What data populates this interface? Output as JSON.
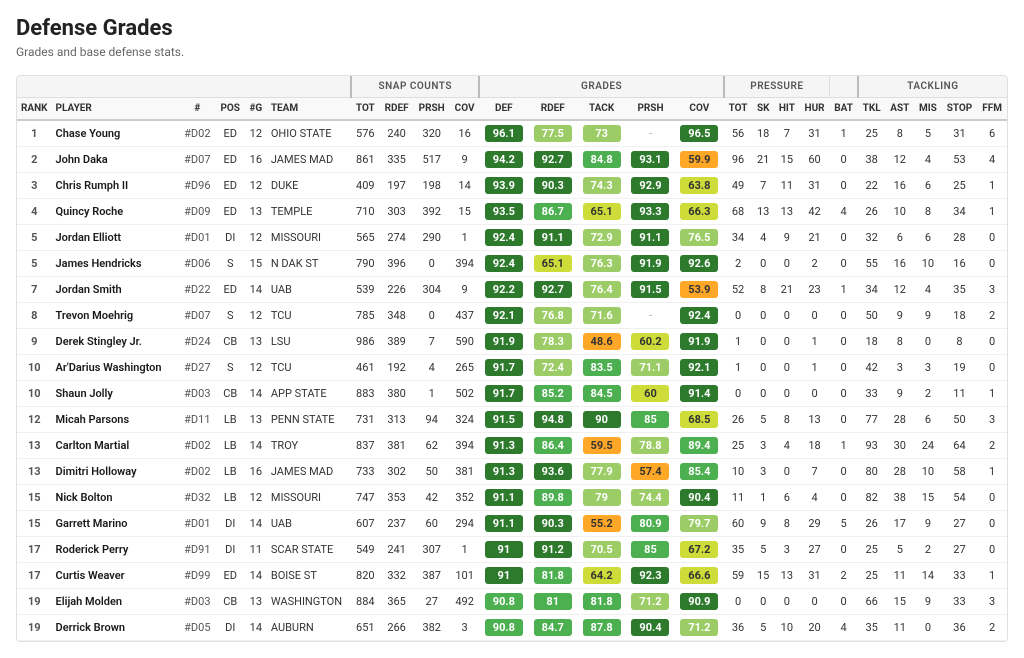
{
  "title": "Defense Grades",
  "subtitle": "Grades and base defense stats.",
  "groups": [
    {
      "label": "",
      "span": 6
    },
    {
      "label": "SNAP COUNTS",
      "span": 4
    },
    {
      "label": "GRADES",
      "span": 5
    },
    {
      "label": "PRESSURE",
      "span": 4
    },
    {
      "label": "TACKLING",
      "span": 5
    }
  ],
  "columns": [
    "RANK",
    "PLAYER",
    "#",
    "POS",
    "#G",
    "TEAM",
    "TOT",
    "RDEF",
    "PRSH",
    "COV",
    "DEF",
    "RDEF",
    "TACK",
    "PRSH",
    "COV",
    "TOT",
    "SK",
    "HIT",
    "HUR",
    "BAT",
    "TKL",
    "AST",
    "MIS",
    "STOP",
    "FFM"
  ],
  "rows": [
    {
      "rank": 1,
      "player": "Chase Young",
      "num": "#D02",
      "pos": "ED",
      "g": 12,
      "team": "OHIO STATE",
      "tot": 576,
      "rdef": 240,
      "prsh": 320,
      "cov": 16,
      "def": 96.1,
      "def_c": "g-green-dark",
      "rdef_g": 77.5,
      "rdef_c": "g-yellow-green",
      "tack": 73.0,
      "tack_c": "g-yellow-green",
      "prsh_g": "-",
      "prsh_c": "",
      "cov_g": 96.5,
      "cov_c": "g-green-dark",
      "p_tot": 56,
      "sk": 18,
      "hit": 7,
      "hur": 31,
      "bat": 1,
      "tkl": 25,
      "ast": 8,
      "mis": 5,
      "stop": 31,
      "ffm": 6
    },
    {
      "rank": 2,
      "player": "John Daka",
      "num": "#D07",
      "pos": "ED",
      "g": 16,
      "team": "JAMES MAD",
      "tot": 861,
      "rdef": 335,
      "prsh": 517,
      "cov": 9,
      "def": 94.2,
      "def_c": "g-green-dark",
      "rdef_g": 92.7,
      "rdef_c": "g-green-dark",
      "tack": 84.8,
      "tack_c": "g-green",
      "prsh_g": 93.1,
      "prsh_c": "g-green-dark",
      "cov_g": 59.9,
      "cov_c": "g-orange",
      "p_tot": 96,
      "sk": 21,
      "hit": 15,
      "hur": 60,
      "bat": 0,
      "tkl": 38,
      "ast": 12,
      "mis": 4,
      "stop": 53,
      "ffm": 4
    },
    {
      "rank": 3,
      "player": "Chris Rumph II",
      "num": "#D96",
      "pos": "ED",
      "g": 12,
      "team": "DUKE",
      "tot": 409,
      "rdef": 197,
      "prsh": 198,
      "cov": 14,
      "def": 93.9,
      "def_c": "g-green-dark",
      "rdef_g": 90.3,
      "rdef_c": "g-green-dark",
      "tack": 74.3,
      "tack_c": "g-yellow-green",
      "prsh_g": 92.9,
      "prsh_c": "g-green-dark",
      "cov_g": 63.8,
      "cov_c": "g-yellow",
      "p_tot": 49,
      "sk": 7,
      "hit": 11,
      "hur": 31,
      "bat": 0,
      "tkl": 22,
      "ast": 16,
      "mis": 6,
      "stop": 25,
      "ffm": 1
    },
    {
      "rank": 4,
      "player": "Quincy Roche",
      "num": "#D09",
      "pos": "ED",
      "g": 13,
      "team": "TEMPLE",
      "tot": 710,
      "rdef": 303,
      "prsh": 392,
      "cov": 15,
      "def": 93.5,
      "def_c": "g-green-dark",
      "rdef_g": 86.7,
      "rdef_c": "g-green",
      "tack": 65.1,
      "tack_c": "g-yellow",
      "prsh_g": 93.3,
      "prsh_c": "g-green-dark",
      "cov_g": 66.3,
      "cov_c": "g-yellow",
      "p_tot": 68,
      "sk": 13,
      "hit": 13,
      "hur": 42,
      "bat": 4,
      "tkl": 26,
      "ast": 10,
      "mis": 8,
      "stop": 34,
      "ffm": 1
    },
    {
      "rank": 5,
      "player": "Jordan Elliott",
      "num": "#D01",
      "pos": "DI",
      "g": 12,
      "team": "MISSOURI",
      "tot": 565,
      "rdef": 274,
      "prsh": 290,
      "cov": 1,
      "def": 92.4,
      "def_c": "g-green-dark",
      "rdef_g": 91.1,
      "rdef_c": "g-green-dark",
      "tack": 72.9,
      "tack_c": "g-yellow-green",
      "prsh_g": 91.1,
      "prsh_c": "g-green-dark",
      "cov_g": 76.5,
      "cov_c": "g-yellow-green",
      "p_tot": 34,
      "sk": 4,
      "hit": 9,
      "hur": 21,
      "bat": 0,
      "tkl": 32,
      "ast": 6,
      "mis": 6,
      "stop": 28,
      "ffm": 0
    },
    {
      "rank": 5,
      "player": "James Hendricks",
      "num": "#D06",
      "pos": "S",
      "g": 15,
      "team": "N DAK ST",
      "tot": 790,
      "rdef": 396,
      "prsh": 0,
      "cov": 394,
      "def": 92.4,
      "def_c": "g-green-dark",
      "rdef_g": 65.1,
      "rdef_c": "g-yellow",
      "tack": 76.3,
      "tack_c": "g-yellow-green",
      "prsh_g": 91.9,
      "prsh_c": "g-green-dark",
      "cov_g": 92.6,
      "cov_c": "g-green-dark",
      "p_tot": 2,
      "sk": 0,
      "hit": 0,
      "hur": 2,
      "bat": 0,
      "tkl": 55,
      "ast": 16,
      "mis": 10,
      "stop": 16,
      "ffm": 0
    },
    {
      "rank": 7,
      "player": "Jordan Smith",
      "num": "#D22",
      "pos": "ED",
      "g": 14,
      "team": "UAB",
      "tot": 539,
      "rdef": 226,
      "prsh": 304,
      "cov": 9,
      "def": 92.2,
      "def_c": "g-green-dark",
      "rdef_g": 92.7,
      "rdef_c": "g-green-dark",
      "tack": 76.4,
      "tack_c": "g-yellow-green",
      "prsh_g": 91.5,
      "prsh_c": "g-green-dark",
      "cov_g": 53.9,
      "cov_c": "g-orange",
      "p_tot": 52,
      "sk": 8,
      "hit": 21,
      "hur": 23,
      "bat": 1,
      "tkl": 34,
      "ast": 12,
      "mis": 4,
      "stop": 35,
      "ffm": 3
    },
    {
      "rank": 8,
      "player": "Trevon Moehrig",
      "num": "#D07",
      "pos": "S",
      "g": 12,
      "team": "TCU",
      "tot": 785,
      "rdef": 348,
      "prsh": 0,
      "cov": 437,
      "def": 92.1,
      "def_c": "g-green-dark",
      "rdef_g": 76.8,
      "rdef_c": "g-yellow-green",
      "tack": 71.6,
      "tack_c": "g-yellow-green",
      "prsh_g": "-",
      "prsh_c": "",
      "cov_g": 92.4,
      "cov_c": "g-green-dark",
      "p_tot": 0,
      "sk": 0,
      "hit": 0,
      "hur": 0,
      "bat": 0,
      "tkl": 50,
      "ast": 9,
      "mis": 9,
      "stop": 18,
      "ffm": 2
    },
    {
      "rank": 9,
      "player": "Derek Stingley Jr.",
      "num": "#D24",
      "pos": "CB",
      "g": 13,
      "team": "LSU",
      "tot": 986,
      "rdef": 389,
      "prsh": 7,
      "cov": 590,
      "def": 91.9,
      "def_c": "g-green-dark",
      "rdef_g": 78.3,
      "rdef_c": "g-yellow-green",
      "tack": 48.6,
      "tack_c": "g-orange",
      "prsh_g": 60.2,
      "prsh_c": "g-yellow",
      "cov_g": 91.9,
      "cov_c": "g-green-dark",
      "p_tot": 1,
      "sk": 0,
      "hit": 0,
      "hur": 1,
      "bat": 0,
      "tkl": 18,
      "ast": 8,
      "mis": 0,
      "stop": 8,
      "ffm": 0
    },
    {
      "rank": 10,
      "player": "Ar'Darius Washington",
      "num": "#D27",
      "pos": "S",
      "g": 12,
      "team": "TCU",
      "tot": 461,
      "rdef": 192,
      "prsh": 4,
      "cov": 265,
      "def": 91.7,
      "def_c": "g-green-dark",
      "rdef_g": 72.4,
      "rdef_c": "g-yellow-green",
      "tack": 83.5,
      "tack_c": "g-green",
      "prsh_g": 71.1,
      "prsh_c": "g-yellow-green",
      "cov_g": 92.1,
      "cov_c": "g-green-dark",
      "p_tot": 1,
      "sk": 0,
      "hit": 0,
      "hur": 1,
      "bat": 0,
      "tkl": 42,
      "ast": 3,
      "mis": 3,
      "stop": 19,
      "ffm": 0
    },
    {
      "rank": 10,
      "player": "Shaun Jolly",
      "num": "#D03",
      "pos": "CB",
      "g": 14,
      "team": "APP STATE",
      "tot": 883,
      "rdef": 380,
      "prsh": 1,
      "cov": 502,
      "def": 91.7,
      "def_c": "g-green-dark",
      "rdef_g": 85.2,
      "rdef_c": "g-green",
      "tack": 84.5,
      "tack_c": "g-green",
      "prsh_g": 60.0,
      "prsh_c": "g-yellow",
      "cov_g": 91.4,
      "cov_c": "g-green-dark",
      "p_tot": 0,
      "sk": 0,
      "hit": 0,
      "hur": 0,
      "bat": 0,
      "tkl": 33,
      "ast": 9,
      "mis": 2,
      "stop": 11,
      "ffm": 1
    },
    {
      "rank": 12,
      "player": "Micah Parsons",
      "num": "#D11",
      "pos": "LB",
      "g": 13,
      "team": "PENN STATE",
      "tot": 731,
      "rdef": 313,
      "prsh": 94,
      "cov": 324,
      "def": 91.5,
      "def_c": "g-green-dark",
      "rdef_g": 94.8,
      "rdef_c": "g-green-dark",
      "tack": 90.0,
      "tack_c": "g-green-dark",
      "prsh_g": 85.0,
      "prsh_c": "g-green",
      "cov_g": 68.5,
      "cov_c": "g-yellow",
      "p_tot": 26,
      "sk": 5,
      "hit": 8,
      "hur": 13,
      "bat": 0,
      "tkl": 77,
      "ast": 28,
      "mis": 6,
      "stop": 50,
      "ffm": 3
    },
    {
      "rank": 13,
      "player": "Carlton Martial",
      "num": "#D02",
      "pos": "LB",
      "g": 14,
      "team": "TROY",
      "tot": 837,
      "rdef": 381,
      "prsh": 62,
      "cov": 394,
      "def": 91.3,
      "def_c": "g-green-dark",
      "rdef_g": 86.4,
      "rdef_c": "g-green",
      "tack": 59.5,
      "tack_c": "g-orange",
      "prsh_g": 78.8,
      "prsh_c": "g-yellow-green",
      "cov_g": 89.4,
      "cov_c": "g-green",
      "p_tot": 25,
      "sk": 3,
      "hit": 4,
      "hur": 18,
      "bat": 1,
      "tkl": 93,
      "ast": 30,
      "mis": 24,
      "stop": 64,
      "ffm": 2
    },
    {
      "rank": 13,
      "player": "Dimitri Holloway",
      "num": "#D02",
      "pos": "LB",
      "g": 16,
      "team": "JAMES MAD",
      "tot": 733,
      "rdef": 302,
      "prsh": 50,
      "cov": 381,
      "def": 91.3,
      "def_c": "g-green-dark",
      "rdef_g": 93.6,
      "rdef_c": "g-green-dark",
      "tack": 77.9,
      "tack_c": "g-yellow-green",
      "prsh_g": 57.4,
      "prsh_c": "g-orange",
      "cov_g": 85.4,
      "cov_c": "g-green",
      "p_tot": 10,
      "sk": 3,
      "hit": 0,
      "hur": 7,
      "bat": 0,
      "tkl": 80,
      "ast": 28,
      "mis": 10,
      "stop": 58,
      "ffm": 1
    },
    {
      "rank": 15,
      "player": "Nick Bolton",
      "num": "#D32",
      "pos": "LB",
      "g": 12,
      "team": "MISSOURI",
      "tot": 747,
      "rdef": 353,
      "prsh": 42,
      "cov": 352,
      "def": 91.1,
      "def_c": "g-green-dark",
      "rdef_g": 89.8,
      "rdef_c": "g-green",
      "tack": 79.0,
      "tack_c": "g-yellow-green",
      "prsh_g": 74.4,
      "prsh_c": "g-yellow-green",
      "cov_g": 90.4,
      "cov_c": "g-green-dark",
      "p_tot": 11,
      "sk": 1,
      "hit": 6,
      "hur": 4,
      "bat": 0,
      "tkl": 82,
      "ast": 38,
      "mis": 15,
      "stop": 54,
      "ffm": 0
    },
    {
      "rank": 15,
      "player": "Garrett Marino",
      "num": "#D01",
      "pos": "DI",
      "g": 14,
      "team": "UAB",
      "tot": 607,
      "rdef": 237,
      "prsh": 60,
      "cov": 294,
      "def": 91.1,
      "def_c": "g-green-dark",
      "rdef_g": 90.3,
      "rdef_c": "g-green-dark",
      "tack": 55.2,
      "tack_c": "g-orange",
      "prsh_g": 80.9,
      "prsh_c": "g-green",
      "cov_g": 79.7,
      "cov_c": "g-yellow-green",
      "p_tot": 60,
      "sk": 9,
      "hit": 8,
      "hur": 29,
      "bat": 5,
      "tkl": 26,
      "ast": 17,
      "mis": 9,
      "stop": 27,
      "ffm": 0
    },
    {
      "rank": 17,
      "player": "Roderick Perry",
      "num": "#D91",
      "pos": "DI",
      "g": 11,
      "team": "SCAR STATE",
      "tot": 549,
      "rdef": 241,
      "prsh": 307,
      "cov": 1,
      "def": 91.0,
      "def_c": "g-green-dark",
      "rdef_g": 91.2,
      "rdef_c": "g-green-dark",
      "tack": 70.5,
      "tack_c": "g-yellow-green",
      "prsh_g": 85.0,
      "prsh_c": "g-green",
      "cov_g": 67.2,
      "cov_c": "g-yellow",
      "p_tot": 35,
      "sk": 5,
      "hit": 3,
      "hur": 27,
      "bat": 0,
      "tkl": 25,
      "ast": 5,
      "mis": 2,
      "stop": 27,
      "ffm": 0
    },
    {
      "rank": 17,
      "player": "Curtis Weaver",
      "num": "#D99",
      "pos": "ED",
      "g": 14,
      "team": "BOISE ST",
      "tot": 820,
      "rdef": 332,
      "prsh": 387,
      "cov": 101,
      "def": 91.0,
      "def_c": "g-green-dark",
      "rdef_g": 81.8,
      "rdef_c": "g-green",
      "tack": 64.2,
      "tack_c": "g-yellow",
      "prsh_g": 92.3,
      "prsh_c": "g-green-dark",
      "cov_g": 66.6,
      "cov_c": "g-yellow",
      "p_tot": 59,
      "sk": 15,
      "hit": 13,
      "hur": 31,
      "bat": 2,
      "tkl": 25,
      "ast": 11,
      "mis": 14,
      "stop": 33,
      "ffm": 1
    },
    {
      "rank": 19,
      "player": "Elijah Molden",
      "num": "#D03",
      "pos": "CB",
      "g": 13,
      "team": "WASHINGTON",
      "tot": 884,
      "rdef": 365,
      "prsh": 27,
      "cov": 492,
      "def": 90.8,
      "def_c": "g-green",
      "rdef_g": 81.0,
      "rdef_c": "g-green",
      "tack": 81.8,
      "tack_c": "g-green",
      "prsh_g": 71.2,
      "prsh_c": "g-yellow-green",
      "cov_g": 90.9,
      "cov_c": "g-green-dark",
      "p_tot": 0,
      "sk": 0,
      "hit": 0,
      "hur": 0,
      "bat": 0,
      "tkl": 66,
      "ast": 15,
      "mis": 9,
      "stop": 33,
      "ffm": 3
    },
    {
      "rank": 19,
      "player": "Derrick Brown",
      "num": "#D05",
      "pos": "DI",
      "g": 14,
      "team": "AUBURN",
      "tot": 651,
      "rdef": 266,
      "prsh": 382,
      "cov": 3,
      "def": 90.8,
      "def_c": "g-green",
      "rdef_g": 84.7,
      "rdef_c": "g-green",
      "tack": 87.8,
      "tack_c": "g-green",
      "prsh_g": 90.4,
      "prsh_c": "g-green-dark",
      "cov_g": 71.2,
      "cov_c": "g-yellow-green",
      "p_tot": 36,
      "sk": 5,
      "hit": 10,
      "hur": 20,
      "bat": 4,
      "tkl": 35,
      "ast": 11,
      "mis": 0,
      "stop": 36,
      "ffm": 2
    }
  ]
}
